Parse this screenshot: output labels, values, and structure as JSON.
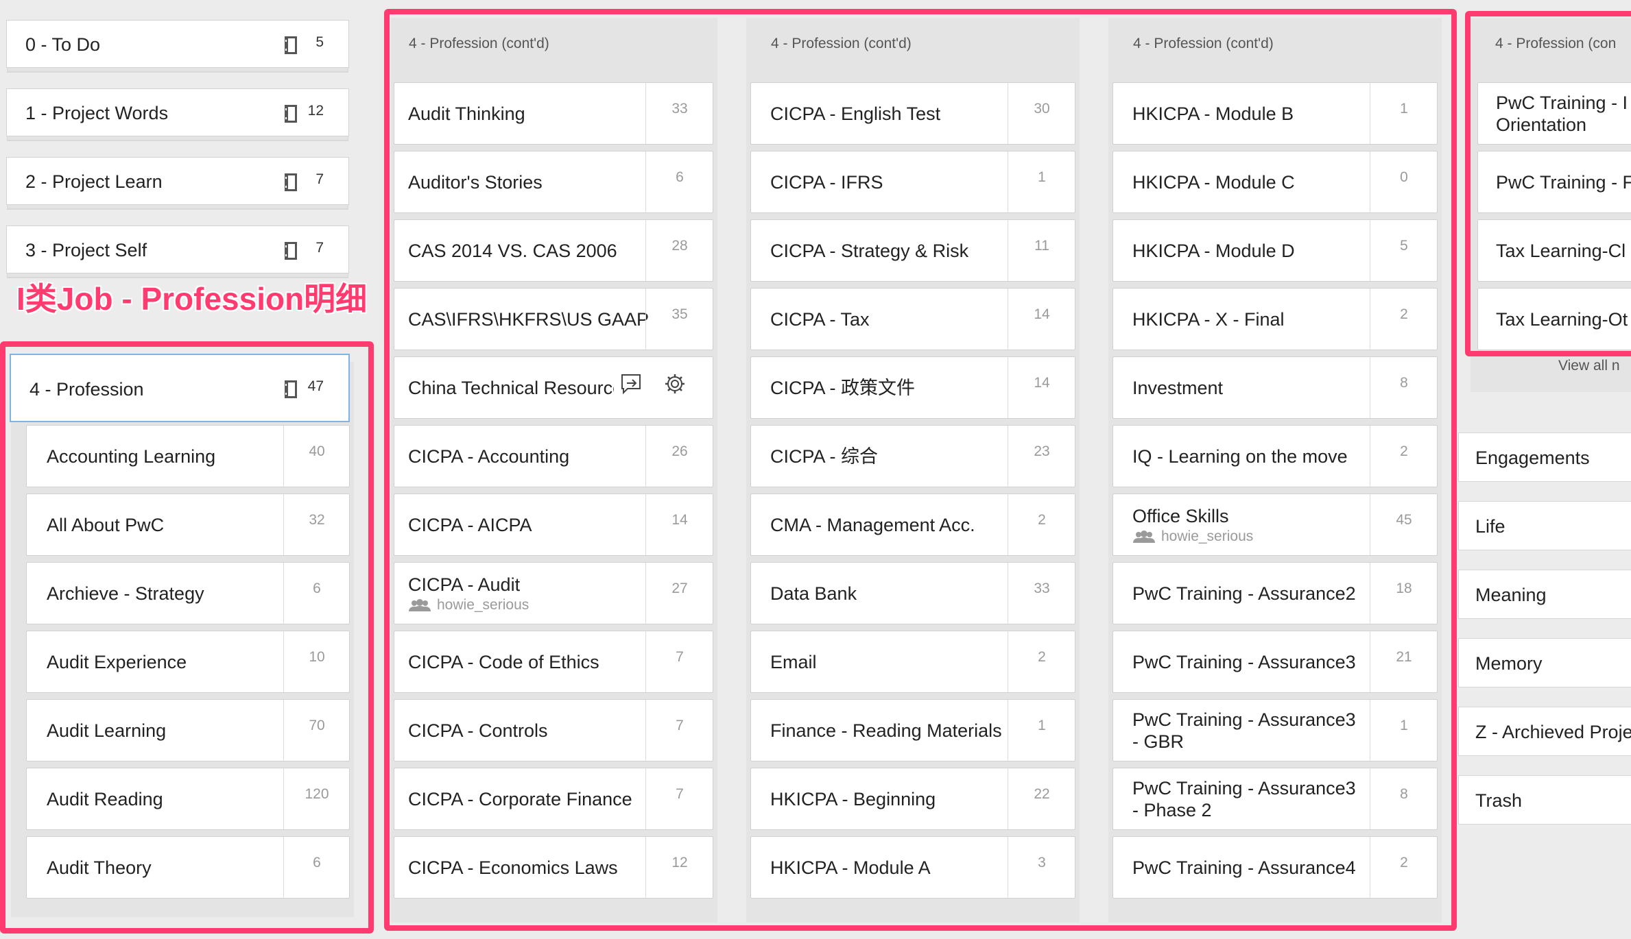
{
  "annotation": {
    "label": "I类Job - Profession明细",
    "color": "#ff3b6f"
  },
  "stacks": [
    {
      "label": "0 - To Do",
      "count": "5"
    },
    {
      "label": "1 - Project Words",
      "count": "12"
    },
    {
      "label": "2 - Project Learn",
      "count": "7"
    },
    {
      "label": "3 - Project Self",
      "count": "7"
    }
  ],
  "profession": {
    "label": "4 - Profession",
    "count": "47"
  },
  "profession_notebooks": [
    {
      "name": "Accounting Learning",
      "count": "40"
    },
    {
      "name": "All About PwC",
      "count": "32"
    },
    {
      "name": "Archieve - Strategy",
      "count": "6"
    },
    {
      "name": "Audit Experience",
      "count": "10"
    },
    {
      "name": "Audit Learning",
      "count": "70"
    },
    {
      "name": "Audit Reading",
      "count": "120"
    },
    {
      "name": "Audit Theory",
      "count": "6"
    }
  ],
  "col1": {
    "header": "4 - Profession (cont'd)",
    "items": [
      {
        "name": "Audit Thinking",
        "count": "33"
      },
      {
        "name": "Auditor's Stories",
        "count": "6"
      },
      {
        "name": "CAS 2014 VS. CAS 2006",
        "count": "28"
      },
      {
        "name": "CAS\\IFRS\\HKFRS\\US GAAP",
        "count": "35"
      },
      {
        "name": "China Technical Resource",
        "count": ""
      },
      {
        "name": "CICPA - Accounting",
        "count": "26"
      },
      {
        "name": "CICPA - AICPA",
        "count": "14"
      },
      {
        "name": "CICPA - Audit",
        "count": "27",
        "owner": "howie_serious"
      },
      {
        "name": "CICPA - Code of Ethics",
        "count": "7"
      },
      {
        "name": "CICPA - Controls",
        "count": "7"
      },
      {
        "name": "CICPA - Corporate Finance",
        "count": "7"
      },
      {
        "name": "CICPA - Economics Laws",
        "count": "12"
      }
    ]
  },
  "col2": {
    "header": "4 - Profession (cont'd)",
    "items": [
      {
        "name": "CICPA - English Test",
        "count": "30"
      },
      {
        "name": "CICPA - IFRS",
        "count": "1"
      },
      {
        "name": "CICPA - Strategy & Risk",
        "count": "11"
      },
      {
        "name": "CICPA - Tax",
        "count": "14"
      },
      {
        "name": "CICPA - 政策文件",
        "count": "14"
      },
      {
        "name": "CICPA - 综合",
        "count": "23"
      },
      {
        "name": "CMA - Management Acc.",
        "count": "2"
      },
      {
        "name": "Data Bank",
        "count": "33"
      },
      {
        "name": "Email",
        "count": "2"
      },
      {
        "name": "Finance - Reading Materials",
        "count": "1"
      },
      {
        "name": "HKICPA - Beginning",
        "count": "22"
      },
      {
        "name": "HKICPA - Module A",
        "count": "3"
      }
    ]
  },
  "col3": {
    "header": "4 - Profession (cont'd)",
    "items": [
      {
        "name": "HKICPA - Module B",
        "count": "1"
      },
      {
        "name": "HKICPA - Module C",
        "count": "0"
      },
      {
        "name": "HKICPA - Module D",
        "count": "5"
      },
      {
        "name": "HKICPA - X - Final",
        "count": "2"
      },
      {
        "name": "Investment",
        "count": "8"
      },
      {
        "name": "IQ - Learning on the move",
        "count": "2"
      },
      {
        "name": "Office Skills",
        "count": "45",
        "owner": "howie_serious"
      },
      {
        "name": "PwC Training - Assurance2",
        "count": "18"
      },
      {
        "name": "PwC Training - Assurance3",
        "count": "21"
      },
      {
        "name": "PwC Training - Assurance3 - GBR",
        "count": "1"
      },
      {
        "name": "PwC Training - Assurance3 - Phase 2",
        "count": "8"
      },
      {
        "name": "PwC Training - Assurance4",
        "count": "2"
      }
    ]
  },
  "col4": {
    "header": "4 - Profession (con",
    "items": [
      {
        "name": "PwC Training - I Orientation"
      },
      {
        "name": "PwC Training - F"
      },
      {
        "name": "Tax Learning-Cl"
      },
      {
        "name": "Tax Learning-Ot"
      }
    ],
    "view_all": "View all n"
  },
  "right_stacks": [
    "Engagements",
    "Life",
    "Meaning",
    "Memory",
    "Z - Archieved Proje",
    "Trash"
  ]
}
